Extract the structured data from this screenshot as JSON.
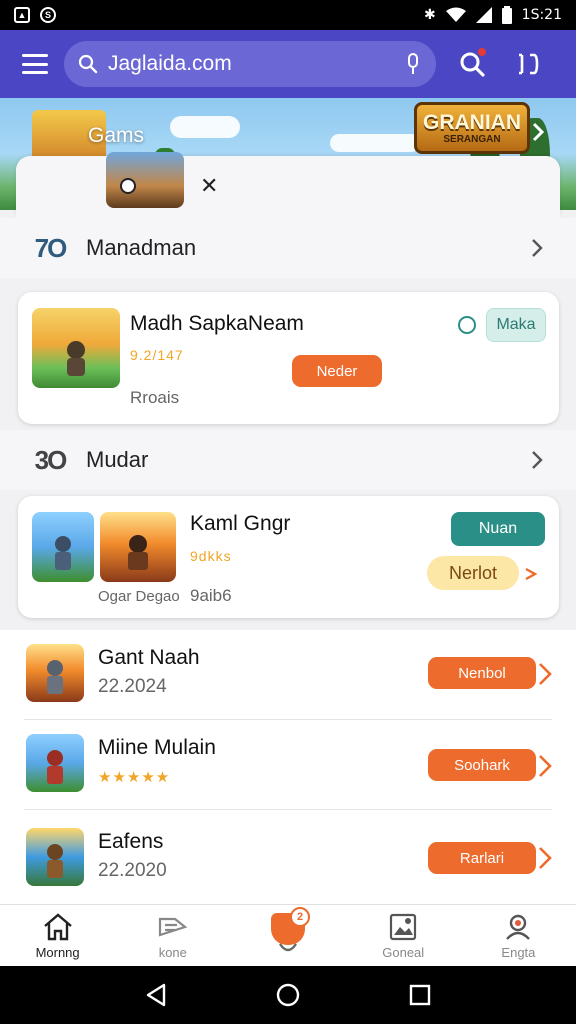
{
  "status_bar": {
    "time": "1S:21"
  },
  "app_bar": {
    "search_value": "Jaglaida.com",
    "search_placeholder": "Search"
  },
  "banner": {
    "title": "Gams",
    "logo_main": "GRANIAN",
    "logo_sub": "SERANGAN"
  },
  "sections": [
    {
      "title": "Manadman",
      "icon_text": "7O"
    },
    {
      "title": "Mudar",
      "icon_text": "3O"
    }
  ],
  "featured_card": {
    "title": "Madh SapkaNeam",
    "rating": "9.2/147",
    "meta": "Rroais",
    "primary_button": "Neder",
    "secondary_button": "Maka"
  },
  "second_card": {
    "title": "Kaml Gngr",
    "rating": "9dkks",
    "meta_left": "Ogar Degao",
    "meta_right": "9aib6",
    "primary_button": "Nuan",
    "secondary_button": "Nerlot"
  },
  "list_items": [
    {
      "title": "Gant Naah",
      "subtitle": "22.2024",
      "button": "Nenbol"
    },
    {
      "title": "Miine Mulain",
      "stars": "★★★★★",
      "button": "Soohark"
    },
    {
      "title": "Eafens",
      "subtitle": "22.2020",
      "button": "Rarlari"
    }
  ],
  "bottom_nav": [
    {
      "label": "Mornng",
      "icon": "home-icon"
    },
    {
      "label": "kone",
      "icon": "ticket-icon"
    },
    {
      "label": "",
      "icon": "download-icon",
      "badge": "2"
    },
    {
      "label": "Goneal",
      "icon": "picture-icon"
    },
    {
      "label": "Engta",
      "icon": "profile-icon"
    }
  ],
  "colors": {
    "app_bar": "#4b47c4",
    "accent_orange": "#ec6b2d",
    "accent_teal": "#2a8f86",
    "rating_gold": "#f0a626"
  }
}
